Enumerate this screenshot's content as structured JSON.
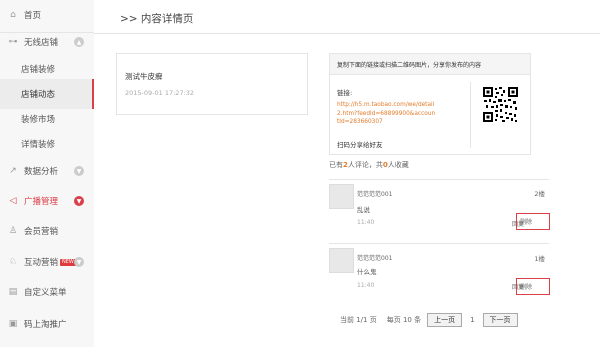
{
  "sidebar": {
    "items": [
      {
        "label": "首页",
        "icon": "home-icon"
      },
      {
        "label": "无线店铺",
        "icon": "wireless-icon"
      },
      {
        "label": "店铺装修"
      },
      {
        "label": "店铺动态"
      },
      {
        "label": "装修市场"
      },
      {
        "label": "详情装修"
      },
      {
        "label": "数据分析",
        "icon": "chart-icon"
      },
      {
        "label": "广播管理",
        "icon": "megaphone-icon"
      },
      {
        "label": "会员营销",
        "icon": "member-icon"
      },
      {
        "label": "互动营销",
        "icon": "interaction-icon",
        "badge": "NEW"
      },
      {
        "label": "自定义菜单",
        "icon": "menu-icon"
      },
      {
        "label": "码上淘推广",
        "icon": "qrcode-icon"
      }
    ]
  },
  "header": {
    "title": ">> 内容详情页"
  },
  "content": {
    "title": "测试牛皮癣",
    "date": "2015-09-01 17:27:32"
  },
  "share": {
    "header": "复制下面的链接或扫描二维码图片，分享你发布的内容",
    "link_label": "链接:",
    "url": "http://h5.m.taobao.com/we/detail2.htm?feedId=68899900&accountId=283660307",
    "scan_label": "扫码分享给好友"
  },
  "summary": {
    "prefix": "已有",
    "count": "2",
    "mid": "人评论，共",
    "fav": "0",
    "suffix": "人收藏"
  },
  "comments": [
    {
      "user": "范范范范001",
      "text": "乱说",
      "time": "11:40",
      "floor": "2楼",
      "reply": "回复",
      "delete": "删除"
    },
    {
      "user": "范范范范001",
      "text": "什么鬼",
      "time": "11:40",
      "floor": "1楼",
      "reply": "回复",
      "delete": "删除"
    }
  ],
  "pager": {
    "info": "当前 1/1 页",
    "per_page": "每页 10 条",
    "prev": "上一页",
    "page": "1",
    "next": "下一页"
  },
  "colors": {
    "accent": "#d9404a",
    "highlight": "#e37b2b"
  }
}
